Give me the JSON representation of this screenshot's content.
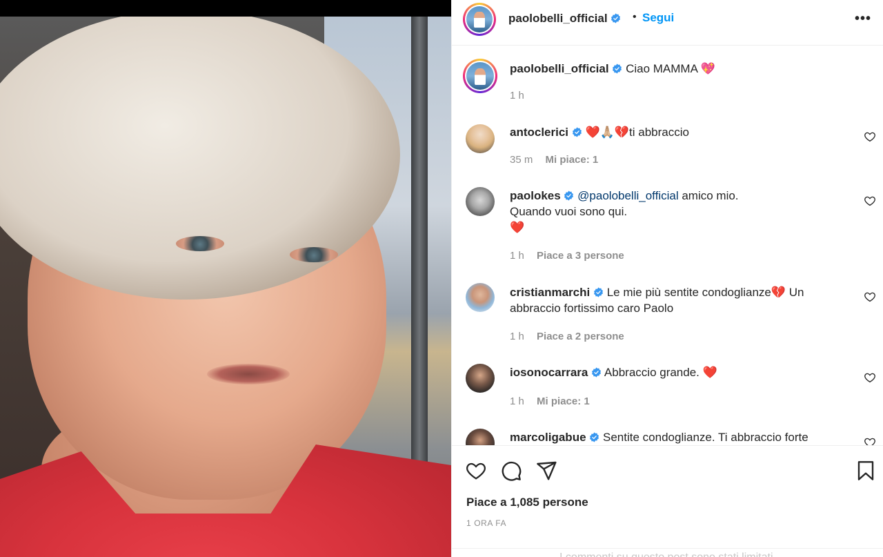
{
  "post": {
    "author": "paolobelli_official",
    "follow_label": "Segui",
    "dot": "•",
    "more_label": "•••",
    "caption": {
      "user": "paolobelli_official",
      "text": "Ciao MAMMA 💖",
      "time": "1 h"
    },
    "comments": [
      {
        "user": "antoclerici",
        "text": "❤️🙏🏼💔ti abbraccio",
        "time": "35 m",
        "likes": "Mi piace: 1"
      },
      {
        "user": "paolokes",
        "mention": "@paolobelli_official",
        "text_after": " amico mio.",
        "line2": "Quando vuoi sono qui.",
        "line3": "❤️",
        "time": "1 h",
        "likes": "Piace a 3 persone"
      },
      {
        "user": "cristianmarchi",
        "text": "Le mie più sentite condoglianze💔 Un abbraccio fortissimo caro Paolo",
        "time": "1 h",
        "likes": "Piace a 2 persone"
      },
      {
        "user": "iosonocarrara",
        "text": "Abbraccio grande. ❤️",
        "time": "1 h",
        "likes": "Mi piace: 1"
      },
      {
        "user": "marcoligabue",
        "text": "Sentite condoglianze. Ti abbraccio forte"
      }
    ],
    "likes_total": "Piace a 1,085 persone",
    "posted_ago": "1 ORA FA",
    "comments_limited": "I commenti su questo post sono stati limitati."
  },
  "icons": {
    "like": "heart-icon",
    "comment": "comment-icon",
    "share": "share-icon",
    "save": "bookmark-icon",
    "verified": "verified-badge-icon",
    "comment_like": "heart-outline-icon"
  },
  "colors": {
    "accent": "#0095f6",
    "verified": "#3897f0",
    "text": "#262626",
    "muted": "#8e8e8e"
  }
}
